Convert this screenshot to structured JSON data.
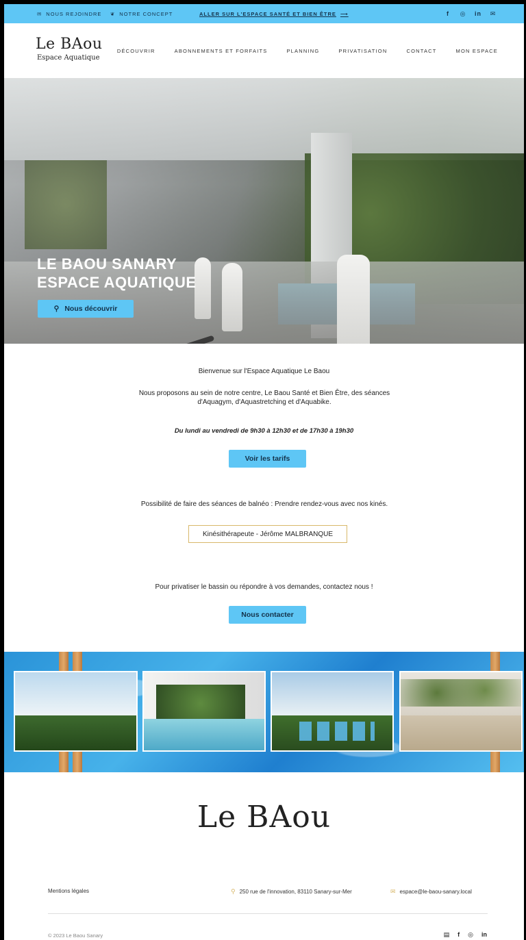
{
  "topbar": {
    "join_label": "NOUS REJOINDRE",
    "concept_label": "NOTRE CONCEPT",
    "link_label": "ALLER SUR L'ESPACE SANTÉ ET BIEN ÊTRE",
    "link_arrow": "⟶",
    "social": [
      "f",
      "◎",
      "in",
      "✉"
    ]
  },
  "logo": {
    "main": "Le BAou",
    "sub": "Espace Aquatique"
  },
  "nav": [
    "DÉCOUVRIR",
    "ABONNEMENTS ET FORFAITS",
    "PLANNING",
    "PRIVATISATION",
    "CONTACT",
    "MON ESPACE"
  ],
  "hero": {
    "title_line1": "LE BAOU SANARY",
    "title_line2": "ESPACE AQUATIQUE",
    "button_label": "Nous découvrir"
  },
  "content": {
    "welcome": "Bienvenue sur l'Espace Aquatique Le Baou",
    "intro": "Nous proposons au sein de notre centre, Le Baou Santé et Bien Être, des séances d'Aquagym, d'Aquastretching et d'Aquabike.",
    "hours": "Du lundi au vendredi de 9h30 à 12h30 et de 17h30 à 19h30",
    "tarifs_button": "Voir les tarifs",
    "balneo": "Possibilité de faire des séances de balnéo : Prendre rendez-vous avec nos kinés.",
    "kine_button": "Kinésithérapeute - Jérôme MALBRANQUE",
    "privatiser": "Pour privatiser le bassin ou répondre à vos demandes, contactez nous !",
    "contact_button": "Nous contacter"
  },
  "footer": {
    "logo": "Le BAou",
    "mentions": "Mentions légales",
    "address": "250 rue de l'innovation, 83110 Sanary-sur-Mer",
    "email": "espace@le-baou-sanary.local",
    "copyright": "© 2023 Le Baou Sanary",
    "social": [
      "▤",
      "f",
      "◎",
      "in"
    ]
  },
  "colors": {
    "accent": "#5ec6f5",
    "gold": "#d8b86a",
    "dark": "#14324a"
  },
  "icons": [
    "envelope-icon",
    "leaf-icon",
    "arrow-right-icon",
    "facebook-icon",
    "instagram-icon",
    "linkedin-icon",
    "mail-icon",
    "search-icon",
    "location-pin-icon",
    "calendar-icon"
  ]
}
